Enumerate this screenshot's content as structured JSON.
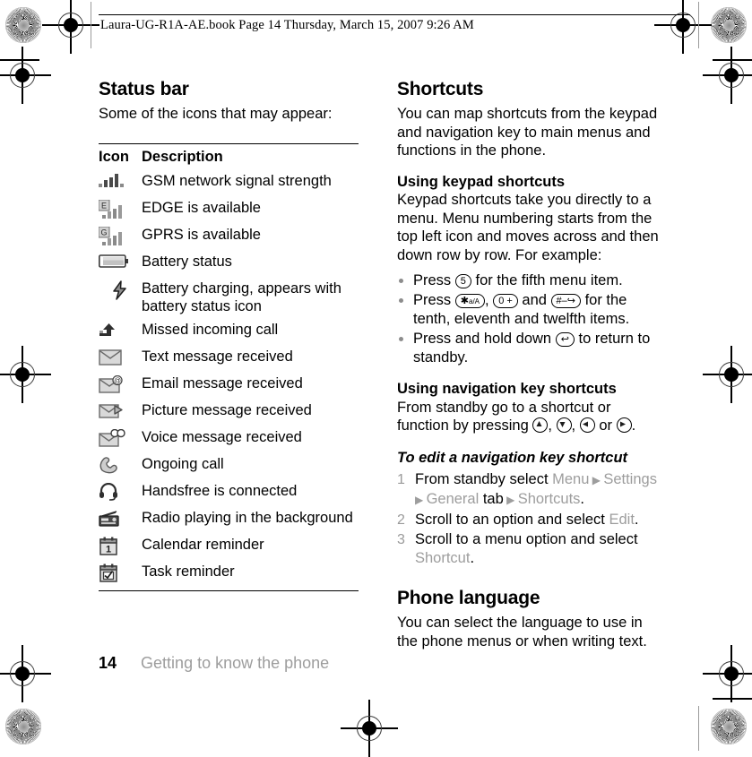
{
  "header": {
    "text": "Laura-UG-R1A-AE.book  Page 14  Thursday, March 15, 2007  9:26 AM"
  },
  "left_column": {
    "title": "Status bar",
    "intro": "Some of the icons that may appear:",
    "table": {
      "columns": [
        "Icon",
        "Description"
      ],
      "rows": [
        {
          "icon": "signal-strength-icon",
          "description": "GSM network signal strength"
        },
        {
          "icon": "edge-available-icon",
          "description": "EDGE is available"
        },
        {
          "icon": "gprs-available-icon",
          "description": "GPRS is available"
        },
        {
          "icon": "battery-status-icon",
          "description": "Battery status"
        },
        {
          "icon": "battery-charging-icon",
          "description": "Battery charging, appears with battery status icon"
        },
        {
          "icon": "missed-call-icon",
          "description": "Missed incoming call"
        },
        {
          "icon": "text-message-icon",
          "description": "Text message received"
        },
        {
          "icon": "email-message-icon",
          "description": "Email message received"
        },
        {
          "icon": "picture-message-icon",
          "description": "Picture message received"
        },
        {
          "icon": "voice-message-icon",
          "description": "Voice message received"
        },
        {
          "icon": "ongoing-call-icon",
          "description": "Ongoing call"
        },
        {
          "icon": "handsfree-icon",
          "description": "Handsfree is connected"
        },
        {
          "icon": "radio-icon",
          "description": "Radio playing in the background"
        },
        {
          "icon": "calendar-reminder-icon",
          "description": "Calendar reminder"
        },
        {
          "icon": "task-reminder-icon",
          "description": "Task reminder"
        }
      ]
    }
  },
  "right_column": {
    "shortcuts": {
      "title": "Shortcuts",
      "intro": "You can map shortcuts from the keypad and navigation key to main menus and functions in the phone."
    },
    "keypad": {
      "subtitle": "Using keypad shortcuts",
      "body": "Keypad shortcuts take you directly to a menu. Menu numbering starts from the top left icon and moves across and then down row by row. For example:",
      "bullets": [
        {
          "before": "Press",
          "keys": [
            "5"
          ],
          "after": "for the fifth menu item."
        },
        {
          "before": "Press",
          "keys": [
            "*a/A",
            "0 +",
            "#-"
          ],
          "after": "for the tenth, eleventh and twelfth items."
        },
        {
          "before": "Press and hold down",
          "keys": [
            "back"
          ],
          "after": "to return to standby."
        }
      ]
    },
    "navigation": {
      "subtitle": "Using navigation key shortcuts",
      "body_before": "From standby go to a shortcut or function by pressing",
      "keys": [
        "up",
        "down",
        "left",
        "right"
      ],
      "separator_or": "or",
      "body_after": "."
    },
    "procedure": {
      "title": "To edit a navigation key shortcut",
      "steps": [
        {
          "parts": [
            {
              "t": "From standby select ",
              "style": "plain"
            },
            {
              "t": "Menu",
              "style": "grey"
            },
            {
              "t": " ▶ ",
              "style": "tri"
            },
            {
              "t": "Settings",
              "style": "grey"
            },
            {
              "t": " ▶ ",
              "style": "tri"
            },
            {
              "t": "General",
              "style": "grey"
            },
            {
              "t": " tab",
              "style": "plain"
            },
            {
              "t": " ▶ ",
              "style": "tri"
            },
            {
              "t": "Shortcuts",
              "style": "grey"
            },
            {
              "t": ".",
              "style": "plain"
            }
          ]
        },
        {
          "parts": [
            {
              "t": "Scroll to an option and select ",
              "style": "plain"
            },
            {
              "t": "Edit",
              "style": "grey"
            },
            {
              "t": ".",
              "style": "plain"
            }
          ]
        },
        {
          "parts": [
            {
              "t": "Scroll to a menu option and select ",
              "style": "plain"
            },
            {
              "t": "Shortcut",
              "style": "grey"
            },
            {
              "t": ".",
              "style": "plain"
            }
          ]
        }
      ]
    },
    "phone_language": {
      "title": "Phone language",
      "body": "You can select the language to use in the phone menus or when writing text."
    }
  },
  "footer": {
    "page_number": "14",
    "section": "Getting to know the phone"
  },
  "colors": {
    "text": "#000000",
    "grey_term": "#9d9d9d",
    "rule": "#000000",
    "icon_dark": "#4a4a4a",
    "icon_light": "#c8c8c8"
  }
}
